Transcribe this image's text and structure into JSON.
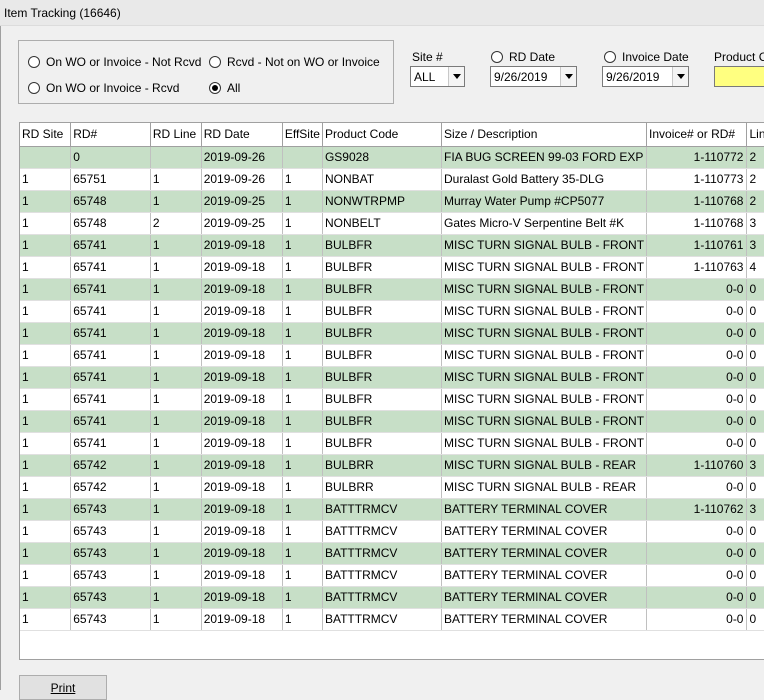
{
  "window": {
    "title": "Item Tracking (16646)"
  },
  "filters": {
    "options": [
      {
        "label": "On WO or Invoice - Not Rcvd",
        "checked": false
      },
      {
        "label": "Rcvd - Not on WO or Invoice",
        "checked": false
      },
      {
        "label": "On WO or Invoice - Rcvd",
        "checked": false
      },
      {
        "label": "All",
        "checked": true
      }
    ]
  },
  "site": {
    "label": "Site #",
    "value": "ALL"
  },
  "rd_date": {
    "label": "RD Date",
    "value": "9/26/2019"
  },
  "invoice_date": {
    "label": "Invoice Date",
    "value": "9/26/2019"
  },
  "product_code": {
    "label": "Product C",
    "value": ""
  },
  "table": {
    "columns": [
      "RD Site",
      "RD#",
      "RD Line",
      "RD Date",
      "EffSite",
      "Product Code",
      "Size / Description",
      "Invoice# or RD#",
      "Lin"
    ],
    "rows": [
      [
        "",
        "0",
        "",
        "2019-09-26",
        "",
        "GS9028",
        "FIA BUG SCREEN 99-03 FORD EXP",
        "1-110772",
        "2"
      ],
      [
        "1",
        "65751",
        "1",
        "2019-09-26",
        "1",
        "NONBAT",
        "Duralast Gold Battery 35-DLG",
        "1-110773",
        "2"
      ],
      [
        "1",
        "65748",
        "1",
        "2019-09-25",
        "1",
        "NONWTRPMP",
        "Murray Water Pump #CP5077",
        "1-110768",
        "2"
      ],
      [
        "1",
        "65748",
        "2",
        "2019-09-25",
        "1",
        "NONBELT",
        "Gates Micro-V Serpentine Belt #K",
        "1-110768",
        "3"
      ],
      [
        "1",
        "65741",
        "1",
        "2019-09-18",
        "1",
        "BULBFR",
        "MISC TURN SIGNAL BULB - FRONT",
        "1-110761",
        "3"
      ],
      [
        "1",
        "65741",
        "1",
        "2019-09-18",
        "1",
        "BULBFR",
        "MISC TURN SIGNAL BULB - FRONT",
        "1-110763",
        "4"
      ],
      [
        "1",
        "65741",
        "1",
        "2019-09-18",
        "1",
        "BULBFR",
        "MISC TURN SIGNAL BULB - FRONT",
        "0-0",
        "0"
      ],
      [
        "1",
        "65741",
        "1",
        "2019-09-18",
        "1",
        "BULBFR",
        "MISC TURN SIGNAL BULB - FRONT",
        "0-0",
        "0"
      ],
      [
        "1",
        "65741",
        "1",
        "2019-09-18",
        "1",
        "BULBFR",
        "MISC TURN SIGNAL BULB - FRONT",
        "0-0",
        "0"
      ],
      [
        "1",
        "65741",
        "1",
        "2019-09-18",
        "1",
        "BULBFR",
        "MISC TURN SIGNAL BULB - FRONT",
        "0-0",
        "0"
      ],
      [
        "1",
        "65741",
        "1",
        "2019-09-18",
        "1",
        "BULBFR",
        "MISC TURN SIGNAL BULB - FRONT",
        "0-0",
        "0"
      ],
      [
        "1",
        "65741",
        "1",
        "2019-09-18",
        "1",
        "BULBFR",
        "MISC TURN SIGNAL BULB - FRONT",
        "0-0",
        "0"
      ],
      [
        "1",
        "65741",
        "1",
        "2019-09-18",
        "1",
        "BULBFR",
        "MISC TURN SIGNAL BULB - FRONT",
        "0-0",
        "0"
      ],
      [
        "1",
        "65741",
        "1",
        "2019-09-18",
        "1",
        "BULBFR",
        "MISC TURN SIGNAL BULB - FRONT",
        "0-0",
        "0"
      ],
      [
        "1",
        "65742",
        "1",
        "2019-09-18",
        "1",
        "BULBRR",
        "MISC TURN SIGNAL BULB - REAR",
        "1-110760",
        "3"
      ],
      [
        "1",
        "65742",
        "1",
        "2019-09-18",
        "1",
        "BULBRR",
        "MISC TURN SIGNAL BULB - REAR",
        "0-0",
        "0"
      ],
      [
        "1",
        "65743",
        "1",
        "2019-09-18",
        "1",
        "BATTTRMCV",
        "BATTERY TERMINAL COVER",
        "1-110762",
        "3"
      ],
      [
        "1",
        "65743",
        "1",
        "2019-09-18",
        "1",
        "BATTTRMCV",
        "BATTERY TERMINAL COVER",
        "0-0",
        "0"
      ],
      [
        "1",
        "65743",
        "1",
        "2019-09-18",
        "1",
        "BATTTRMCV",
        "BATTERY TERMINAL COVER",
        "0-0",
        "0"
      ],
      [
        "1",
        "65743",
        "1",
        "2019-09-18",
        "1",
        "BATTTRMCV",
        "BATTERY TERMINAL COVER",
        "0-0",
        "0"
      ],
      [
        "1",
        "65743",
        "1",
        "2019-09-18",
        "1",
        "BATTTRMCV",
        "BATTERY TERMINAL COVER",
        "0-0",
        "0"
      ],
      [
        "1",
        "65743",
        "1",
        "2019-09-18",
        "1",
        "BATTTRMCV",
        "BATTERY TERMINAL COVER",
        "0-0",
        "0"
      ]
    ]
  },
  "footer": {
    "print_label": "Print"
  },
  "colors": {
    "row_alt": "#c7dfc7",
    "input_highlight": "#ffff80"
  }
}
